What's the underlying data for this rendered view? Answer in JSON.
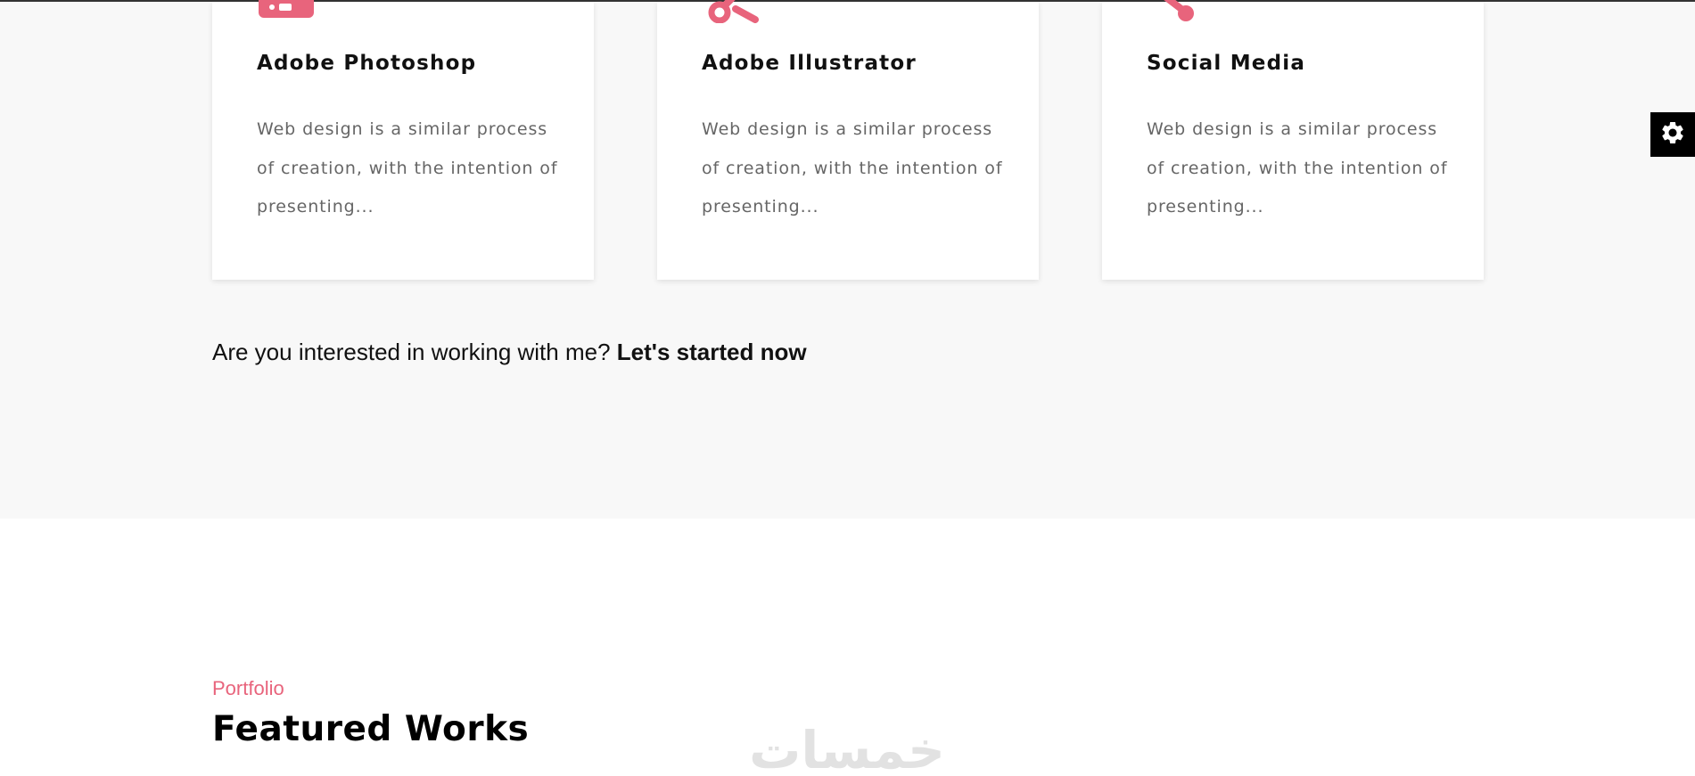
{
  "colors": {
    "accent": "#e8647c",
    "section_background": "#f8f8f8",
    "heading": "#111111",
    "body_text": "#666666",
    "settings_background": "#000000",
    "watermark": "#e2e2e2"
  },
  "services": {
    "cards": [
      {
        "icon": "photoshop-icon",
        "title": "Adobe Photoshop",
        "description": "Web design is a similar process of creation, with the intention of presenting..."
      },
      {
        "icon": "scissors-icon",
        "title": "Adobe Illustrator",
        "description": "Web design is a similar process of creation, with the intention of presenting..."
      },
      {
        "icon": "share-icon",
        "title": "Social Media",
        "description": "Web design is a similar process of creation, with the intention of presenting..."
      }
    ],
    "cta": {
      "text": "Are you interested in working with me?",
      "link_label": "Let's started now"
    }
  },
  "settings": {
    "icon": "gear-icon"
  },
  "portfolio": {
    "kicker": "Portfolio",
    "title": "Featured Works"
  },
  "watermark": {
    "text": "خمسات"
  }
}
